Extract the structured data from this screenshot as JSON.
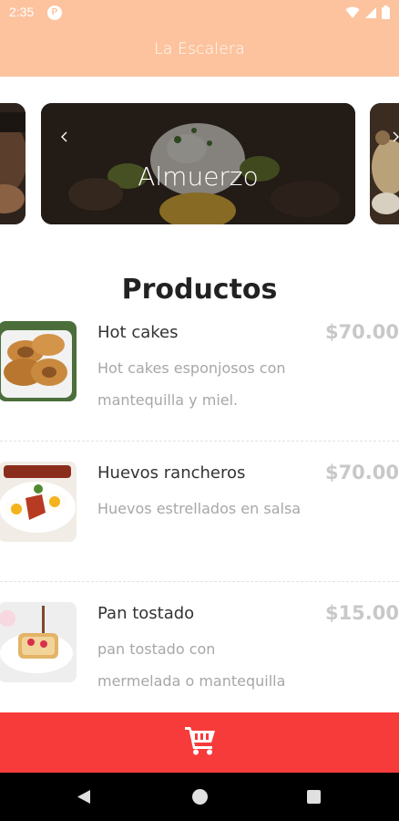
{
  "status_bar": {
    "time": "2:35",
    "app_icon_letter": "P",
    "icons": [
      "wifi-icon",
      "signal-icon",
      "battery-icon"
    ]
  },
  "app_bar": {
    "title": "La Escalera"
  },
  "carousel": {
    "current_title": "Almuerzo",
    "prev_icon": "chevron-left-icon",
    "next_icon": "chevron-right-icon"
  },
  "section": {
    "title": "Productos"
  },
  "products": [
    {
      "name": "Hot cakes",
      "price": "$70.00",
      "description": "Hot cakes esponjosos con mantequilla y miel."
    },
    {
      "name": "Huevos rancheros",
      "price": "$70.00",
      "description": "Huevos estrellados en salsa"
    },
    {
      "name": "Pan tostado",
      "price": "$15.00",
      "description": "pan tostado con mermelada o mantequilla"
    }
  ],
  "cart_bar": {
    "icon": "cart-icon"
  },
  "colors": {
    "header": "#fcc39e",
    "cart_bar": "#f73b3b",
    "price": "#c8c8c8",
    "description": "#a7a7a7"
  }
}
